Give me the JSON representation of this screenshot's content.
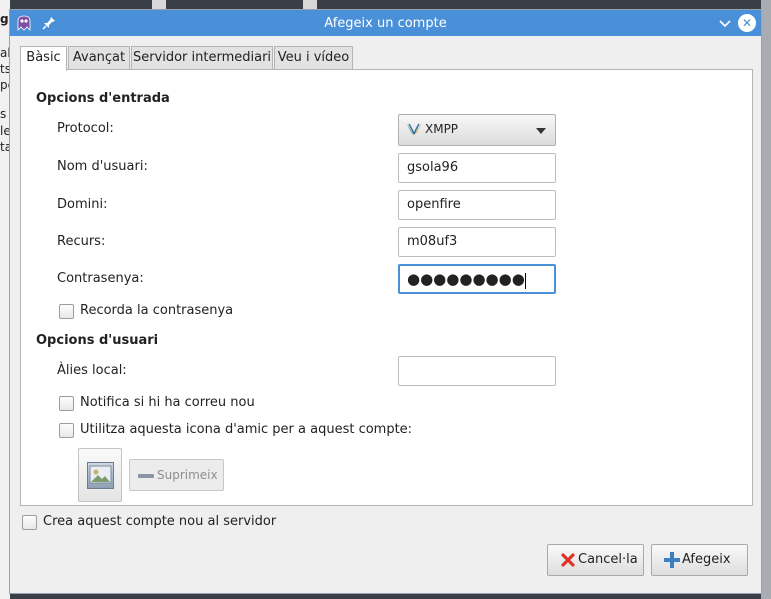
{
  "window": {
    "title": "Afegeix un compte"
  },
  "tabs": [
    {
      "label": "Bàsic",
      "active": true
    },
    {
      "label": "Avançat",
      "active": false
    },
    {
      "label": "Servidor intermediari",
      "active": false
    },
    {
      "label": "Veu i vídeo",
      "active": false
    }
  ],
  "login": {
    "section_title": "Opcions d'entrada",
    "protocol_label": "Protocol:",
    "protocol_value": "XMPP",
    "username_label": "Nom d'usuari:",
    "username_value": "gsola96",
    "domain_label": "Domini:",
    "domain_value": "openfire",
    "resource_label": "Recurs:",
    "resource_value": "m08uf3",
    "password_label": "Contrasenya:",
    "password_masked": "●●●●●●●●●",
    "remember_password_label": "Recorda la contrasenya",
    "remember_password_checked": false
  },
  "user": {
    "section_title": "Opcions d'usuari",
    "local_alias_label": "Àlies local:",
    "local_alias_value": "",
    "notify_mail_label": "Notifica si hi ha correu nou",
    "notify_mail_checked": false,
    "use_buddy_icon_label": "Utilitza aquesta icona d'amic per a aquest compte:",
    "use_buddy_icon_checked": false,
    "remove_label": "Suprimeix"
  },
  "create_on_server_label": "Crea aquest compte nou al servidor",
  "create_on_server_checked": false,
  "buttons": {
    "cancel_label": "Cancel·la",
    "add_label": "Afegeix"
  },
  "background": {
    "left_fragments": [
      "g",
      "ab",
      "ts",
      "pe",
      "s",
      "le",
      "ta"
    ]
  },
  "colors": {
    "titlebar": "#4a90d9",
    "focus_border": "#4a90d9",
    "cancel_icon": "#e0342a",
    "add_icon": "#3d7fc4"
  }
}
